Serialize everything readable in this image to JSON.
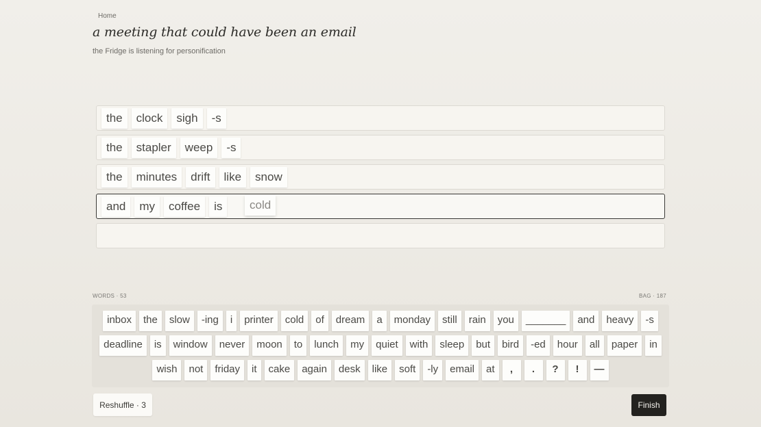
{
  "breadcrumb": "Home",
  "title": "a meeting that could have been an email",
  "subtitle": "the Fridge is listening for personification",
  "poem_lines": [
    [
      "the",
      "clock",
      "sigh",
      "-s"
    ],
    [
      "the",
      "stapler",
      "weep",
      "-s"
    ],
    [
      "the",
      "minutes",
      "drift",
      "like",
      "snow"
    ],
    [
      "and",
      "my",
      "coffee",
      "is"
    ],
    []
  ],
  "dragging_tile": "cold",
  "active_line": 3,
  "words_count": "WORDS · 53",
  "bag_count": "BAG · 187",
  "bag_rows": [
    [
      "inbox",
      "the",
      "slow",
      "-ing",
      "i",
      "printer",
      "cold",
      "of",
      "dream",
      "a",
      "monday",
      "still",
      "rain",
      "you",
      "_______",
      "and",
      "heavy",
      "-s"
    ],
    [
      "deadline",
      "is",
      "window",
      "never",
      "moon",
      "to",
      "lunch",
      "my",
      "quiet",
      "with",
      "sleep",
      "but",
      "bird",
      "-ed",
      "hour",
      "all",
      "paper",
      "in"
    ],
    [
      "wish",
      "not",
      "friday",
      "it",
      "cake",
      "again",
      "desk",
      "like",
      "soft",
      "-ly",
      "email",
      "at",
      ",",
      ".",
      "?",
      "!",
      "—"
    ]
  ],
  "reshuffle_label": "Reshuffle · 3",
  "finish_label": "Finish"
}
